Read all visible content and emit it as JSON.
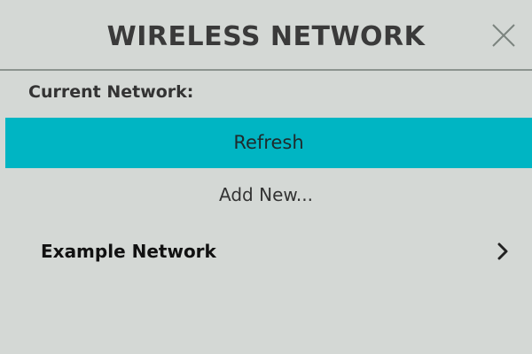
{
  "header": {
    "title": "WIRELESS NETWORK",
    "close_icon": "close-icon"
  },
  "current_network": {
    "label": "Current Network:"
  },
  "actions": {
    "refresh_label": "Refresh",
    "add_new_label": "Add New..."
  },
  "networks": [
    {
      "name": "Example Network",
      "icon": "chevron-right-icon"
    }
  ],
  "colors": {
    "background": "#d4d8d5",
    "accent": "#00b5c3",
    "divider": "#8c948f",
    "title_text": "#3a3a3a"
  }
}
